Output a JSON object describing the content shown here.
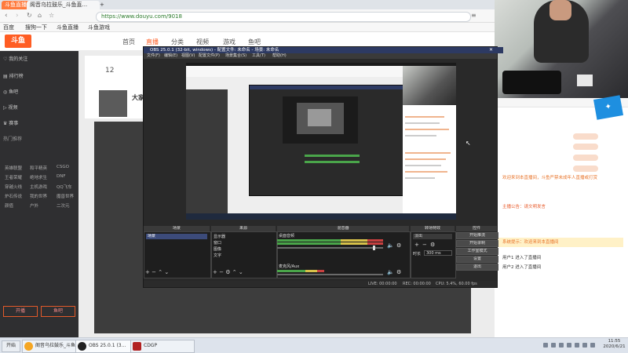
{
  "browser": {
    "tabs": [
      {
        "label": "斗鱼直播",
        "active": false
      },
      {
        "label": "阁音乌拉鼓乐_斗鱼直...",
        "active": true
      },
      {
        "label": "+",
        "active": false
      }
    ],
    "address": "https://www.douyu.com/9018",
    "bookmarks": [
      "百度",
      "搜狗一下",
      "斗鱼直播",
      "斗鱼游戏"
    ]
  },
  "site": {
    "logo_text": "斗鱼",
    "nav": [
      "首页",
      "直播",
      "分类",
      "视频",
      "游戏",
      "鱼吧"
    ]
  },
  "sidebar": {
    "items": [
      "我的关注",
      "排行榜",
      "鱼吧",
      "视频",
      "赛事"
    ],
    "section_title": "热门推荐",
    "grid": [
      [
        "英雄联盟",
        "和平精英",
        "CSGO"
      ],
      [
        "王者荣耀",
        "绝地求生",
        "DNF"
      ],
      [
        "穿越火线",
        "主机游戏",
        "QQ飞车"
      ],
      [
        "炉石传说",
        "我的世界",
        "魔兽世界"
      ],
      [
        "颜值",
        "户外",
        "二次元"
      ]
    ],
    "buttons": [
      "开播",
      "鱼吧"
    ]
  },
  "room": {
    "count": "12",
    "title": "大家好"
  },
  "chat": {
    "lines": [
      {
        "text": "系统提示：欢迎来到本直播间",
        "highlight": true
      },
      {
        "text": "欢迎来到本直播间，斗鱼严禁未成年人直播或打赏",
        "highlight": false
      },
      {
        "text": "主播公告：请文明发言",
        "highlight": false
      },
      {
        "text": "用户1 进入了直播间",
        "highlight": false
      },
      {
        "text": "用户2 进入了直播间",
        "highlight": false
      }
    ]
  },
  "obs": {
    "title": "OBS 25.0.1 (32-bit, windows) - 配置文件: 未命名 - 场景: 未命名",
    "menu": [
      "文件(F)",
      "编辑(E)",
      "视图(V)",
      "配置文件(P)",
      "场景集合(S)",
      "工具(T)",
      "帮助(H)"
    ],
    "docks": [
      "场景",
      "来源",
      "混音器",
      "转场特效",
      "控件"
    ],
    "scene_items": [
      "场景"
    ],
    "source_items": [
      "显示器",
      "窗口",
      "图像",
      "文字"
    ],
    "audio": [
      "桌面音频",
      "麦克风/Aux"
    ],
    "transition": "淡出",
    "duration_label": "时长",
    "duration": "300 ms",
    "controls": [
      "开始推流",
      "开始录制",
      "工作室模式",
      "设置",
      "退出"
    ],
    "status": {
      "live": "LIVE: 00:00:00",
      "rec": "REC: 00:00:00",
      "cpu": "CPU: 5.4%, 60.00 fps"
    }
  },
  "taskbar": {
    "start": "开始",
    "buttons": [
      {
        "label": "阁音乌拉鼓乐_斗鱼...",
        "color": "#f5a623"
      },
      {
        "label": "OBS 25.0.1 (3...",
        "color": "#222222"
      },
      {
        "label": "CDGP",
        "color": "#b22222"
      }
    ],
    "time": "11:55",
    "date": "2020/6/21"
  }
}
